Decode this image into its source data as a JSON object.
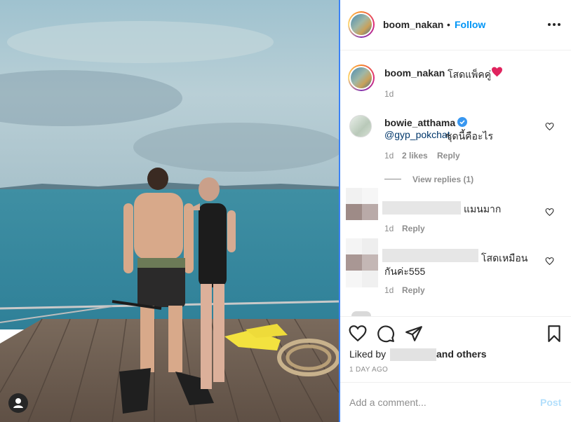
{
  "post": {
    "username": "boom_nakan",
    "follow_label": "Follow",
    "separator": "•",
    "caption": {
      "username": "boom_nakan",
      "text": "โสดแพ็คคู่",
      "emoji": "red-heart",
      "time": "1d"
    }
  },
  "comments": [
    {
      "username": "bowie_atthama",
      "verified": true,
      "mention": "@gyp_pokchat",
      "text": "ชุดนี้คือะไร",
      "time": "1d",
      "likes": "2 likes",
      "reply_label": "Reply",
      "view_replies": "View replies (1)"
    },
    {
      "username": "",
      "text": "แมนมาก",
      "time": "1d",
      "reply_label": "Reply"
    },
    {
      "username": "",
      "text_line1": "โสดเหมือน",
      "text_line2": "กันค่ะ555",
      "time": "1d",
      "reply_label": "Reply"
    }
  ],
  "actions": {
    "liked_by_label": "Liked by",
    "others_label": "and others",
    "date": "1 DAY AGO"
  },
  "comment_box": {
    "placeholder": "Add a comment...",
    "post_label": "Post"
  },
  "icons": {
    "more": "more-horizontal-icon",
    "like": "heart-icon",
    "comment": "comment-icon",
    "share": "paper-plane-icon",
    "save": "bookmark-icon",
    "tagged": "user-tag-icon",
    "verified": "verified-badge-icon"
  },
  "colors": {
    "link": "#0095f6",
    "mention": "#00376b",
    "muted": "#8e8e8e",
    "post_disabled": "#b2dffc",
    "verified": "#3897f0",
    "heart_emoji": "#e0245e"
  }
}
